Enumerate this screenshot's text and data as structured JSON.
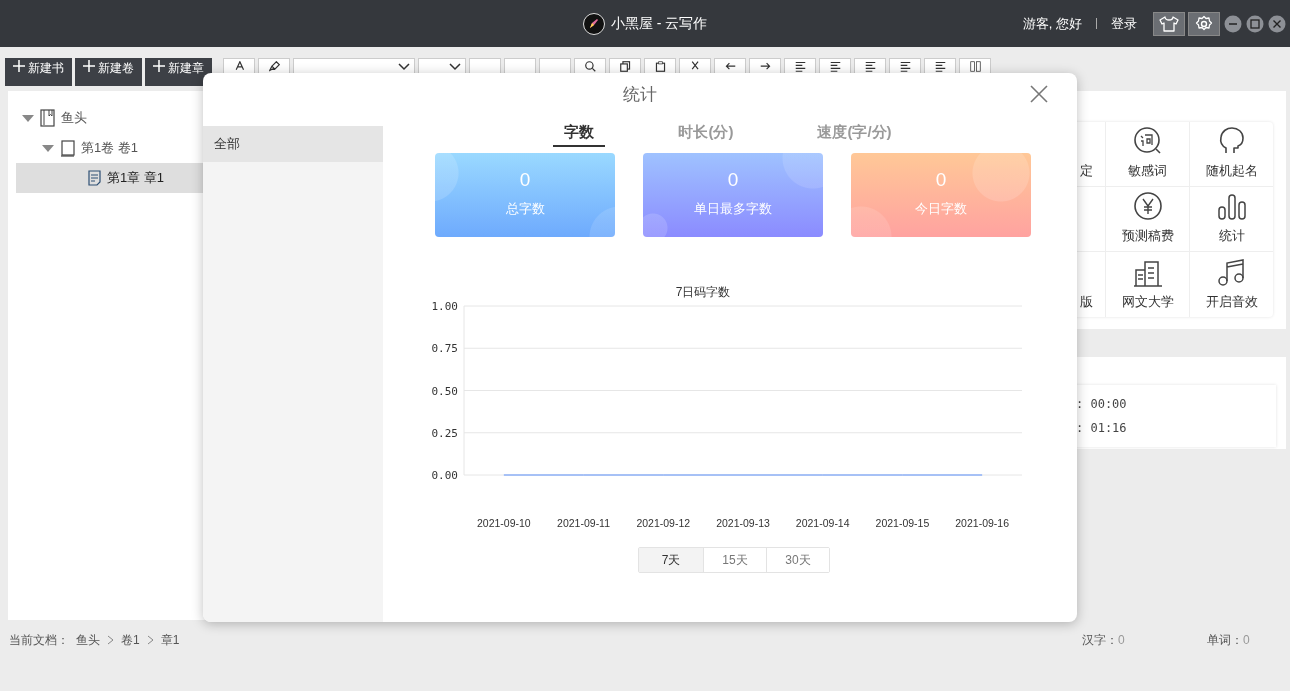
{
  "title_bar": {
    "title": "小黑屋 - 云写作",
    "greeting": "游客, 您好",
    "login": "登录"
  },
  "toolbar": {
    "new_buttons": [
      "新建书",
      "新建卷",
      "新建章"
    ],
    "tools": [
      {
        "kind": "format"
      },
      {
        "kind": "brush"
      },
      {
        "kind": "select"
      },
      {
        "kind": "select"
      },
      {
        "kind": "blank"
      },
      {
        "kind": "blank"
      },
      {
        "kind": "blank"
      },
      {
        "kind": "search"
      },
      {
        "kind": "copy"
      },
      {
        "kind": "paste"
      },
      {
        "kind": "cut"
      },
      {
        "kind": "undo"
      },
      {
        "kind": "redo"
      },
      {
        "kind": "align"
      },
      {
        "kind": "align"
      },
      {
        "kind": "align"
      },
      {
        "kind": "align"
      },
      {
        "kind": "align"
      },
      {
        "kind": "split"
      }
    ]
  },
  "tree": [
    {
      "label": "鱼头",
      "kind": "book",
      "expanded": true,
      "selected": false,
      "children": [
        {
          "label": "第1卷 卷1",
          "kind": "volume",
          "expanded": true,
          "selected": false,
          "children": [
            {
              "label": "第1章 章1",
              "kind": "chapter",
              "selected": true
            }
          ]
        }
      ]
    }
  ],
  "tools_panel": [
    {
      "label": "定"
    },
    {
      "label": "敏感词",
      "kind": "word"
    },
    {
      "label": "随机起名",
      "kind": "head"
    },
    {
      "label": "预测稿费",
      "kind": "yen"
    },
    {
      "label": "统计",
      "kind": "bars"
    },
    {
      "label": "版"
    },
    {
      "label": "网文大学",
      "kind": "building"
    },
    {
      "label": "开启音效",
      "kind": "music"
    }
  ],
  "timer_panel": [
    ": 00:00",
    ": 01:16"
  ],
  "dialog": {
    "title": "统计",
    "sidebar": [
      {
        "label": "全部",
        "selected": true
      }
    ],
    "tabs": [
      {
        "label": "字数",
        "selected": true
      },
      {
        "label": "时长(分)",
        "selected": false
      },
      {
        "label": "速度(字/分)",
        "selected": false
      }
    ],
    "cards": [
      {
        "value": "0",
        "label": "总字数"
      },
      {
        "value": "0",
        "label": "单日最多字数"
      },
      {
        "value": "0",
        "label": "今日字数"
      }
    ],
    "chart_data": {
      "type": "line",
      "title": "7日码字数",
      "categories": [
        "2021-09-10",
        "2021-09-11",
        "2021-09-12",
        "2021-09-13",
        "2021-09-14",
        "2021-09-15",
        "2021-09-16"
      ],
      "values": [
        0,
        0,
        0,
        0,
        0,
        0,
        0
      ],
      "grid": true,
      "ylim": [
        0,
        1
      ],
      "yticks": [
        {
          "value": 0,
          "label": "0.00"
        },
        {
          "value": 0.25,
          "label": "0.25"
        },
        {
          "value": 0.5,
          "label": "0.50"
        },
        {
          "value": 0.75,
          "label": "0.75"
        },
        {
          "value": 1,
          "label": "1.00"
        }
      ]
    },
    "ranges": [
      {
        "label": "7天",
        "selected": true
      },
      {
        "label": "15天",
        "selected": false
      },
      {
        "label": "30天",
        "selected": false
      }
    ]
  },
  "status_bar": {
    "label": "当前文档：",
    "path": [
      "鱼头",
      "卷1",
      "章1"
    ],
    "counts": [
      {
        "label": "汉字：",
        "value": "0"
      },
      {
        "label": "单词：",
        "value": "0"
      }
    ]
  }
}
